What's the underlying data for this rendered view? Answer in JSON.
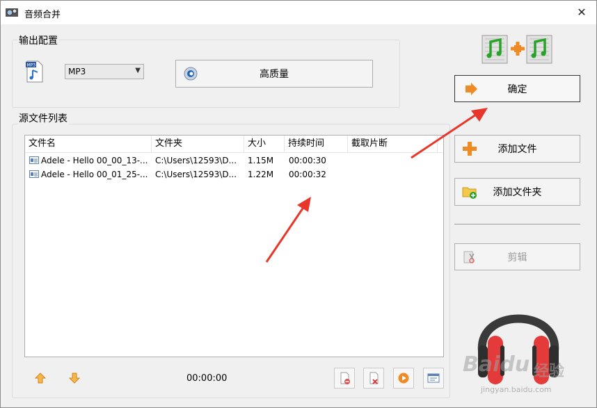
{
  "window": {
    "title": "音频合并"
  },
  "output_config": {
    "label": "输出配置",
    "format_select": "MP3",
    "quality_button": "高质量"
  },
  "confirm_button": "确定",
  "source_list": {
    "label": "源文件列表",
    "columns": [
      "文件名",
      "文件夹",
      "大小",
      "持续时间",
      "截取片断"
    ],
    "rows": [
      {
        "name": "Adele - Hello 00_00_13-...",
        "folder": "C:\\Users\\12593\\D...",
        "size": "1.15M",
        "duration": "00:00:30",
        "clip": ""
      },
      {
        "name": "Adele - Hello 00_01_25-...",
        "folder": "C:\\Users\\12593\\D...",
        "size": "1.22M",
        "duration": "00:00:32",
        "clip": ""
      }
    ]
  },
  "side_buttons": {
    "add_file": "添加文件",
    "add_folder": "添加文件夹",
    "edit": "剪辑"
  },
  "bottom": {
    "total_time": "00:00:00"
  },
  "watermark": {
    "brand": "Baidu",
    "brand_cn": "经验",
    "url": "jingyan.baidu.com"
  },
  "colors": {
    "accent_orange": "#f08a24",
    "arrow_red": "#e8372a",
    "headphone_red": "#e53a3a"
  }
}
